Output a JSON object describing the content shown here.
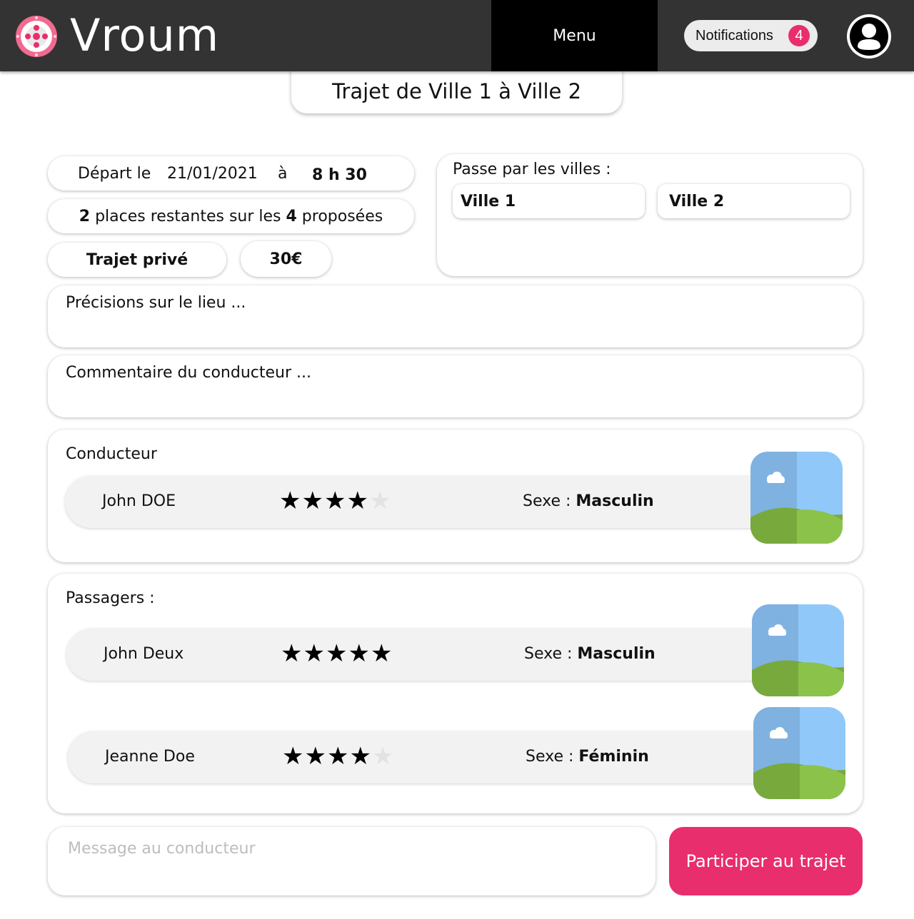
{
  "header": {
    "brand": "Vroum",
    "menu_label": "Menu",
    "notifications_label": "Notifications",
    "notifications_count": "4",
    "accent": "#e82e6d"
  },
  "trip": {
    "title": "Trajet de Ville 1 à Ville 2",
    "departure_label": "Départ le",
    "departure_date": "21/01/2021",
    "at_label": "à",
    "departure_time": "8 h 30",
    "remaining_places": "2",
    "places_text_1": " places restantes sur les ",
    "total_places": "4",
    "places_text_2": " proposées",
    "type": "Trajet privé",
    "price": "30€",
    "via_label": "Passe par les villes :",
    "cities": [
      "Ville 1",
      "Ville 2"
    ],
    "location_details": "Précisions sur le lieu ...",
    "driver_comment": "Commentaire du conducteur ..."
  },
  "driver": {
    "section_label": "Conducteur",
    "name": "John DOE",
    "rating": 4,
    "sex_label": "Sexe :",
    "sex": "Masculin"
  },
  "passengers": {
    "section_label": "Passagers :",
    "items": [
      {
        "name": "John Deux",
        "rating": 5,
        "sex_label": "Sexe :",
        "sex": "Masculin"
      },
      {
        "name": "Jeanne Doe",
        "rating": 4,
        "sex_label": "Sexe :",
        "sex": "Féminin"
      }
    ]
  },
  "message": {
    "placeholder": "Message au conducteur"
  },
  "actions": {
    "participate_label": "Participer au trajet"
  }
}
